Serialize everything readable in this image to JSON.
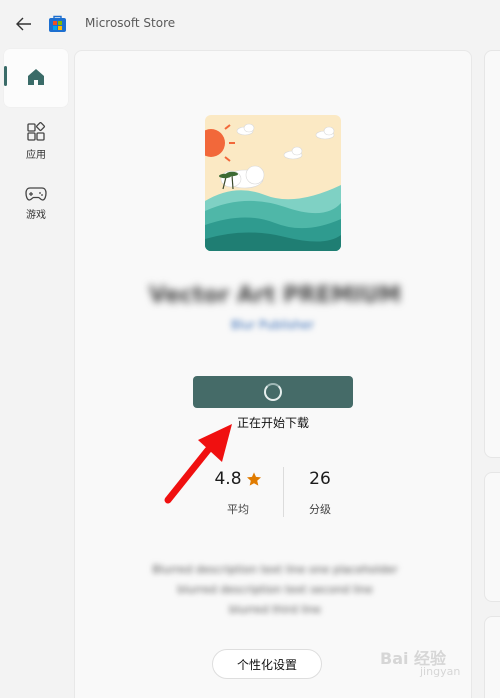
{
  "window": {
    "title": "Microsoft Store"
  },
  "nav": {
    "items": [
      {
        "label": "",
        "icon": "home-icon",
        "selected": true
      },
      {
        "label": "应用",
        "icon": "apps-icon"
      },
      {
        "label": "游戏",
        "icon": "gamepad-icon"
      }
    ]
  },
  "product": {
    "name": "Vector Art PREMIUM",
    "publisher": "Blur Publisher",
    "download_status": "正在开始下载",
    "rating": {
      "value": "4.8",
      "label": "平均"
    },
    "ratings_count": {
      "value": "26",
      "label": "分级"
    },
    "description_lines": [
      "Blurred description text line one placeholder",
      "blurred description text second line",
      "blurred third line"
    ],
    "personalize_label": "个性化设置"
  },
  "watermark": {
    "text": "Bai 经验",
    "sub": "jingyan"
  },
  "colors": {
    "accent": "#456b68",
    "star": "#e07b00",
    "arrow": "#f01010"
  }
}
